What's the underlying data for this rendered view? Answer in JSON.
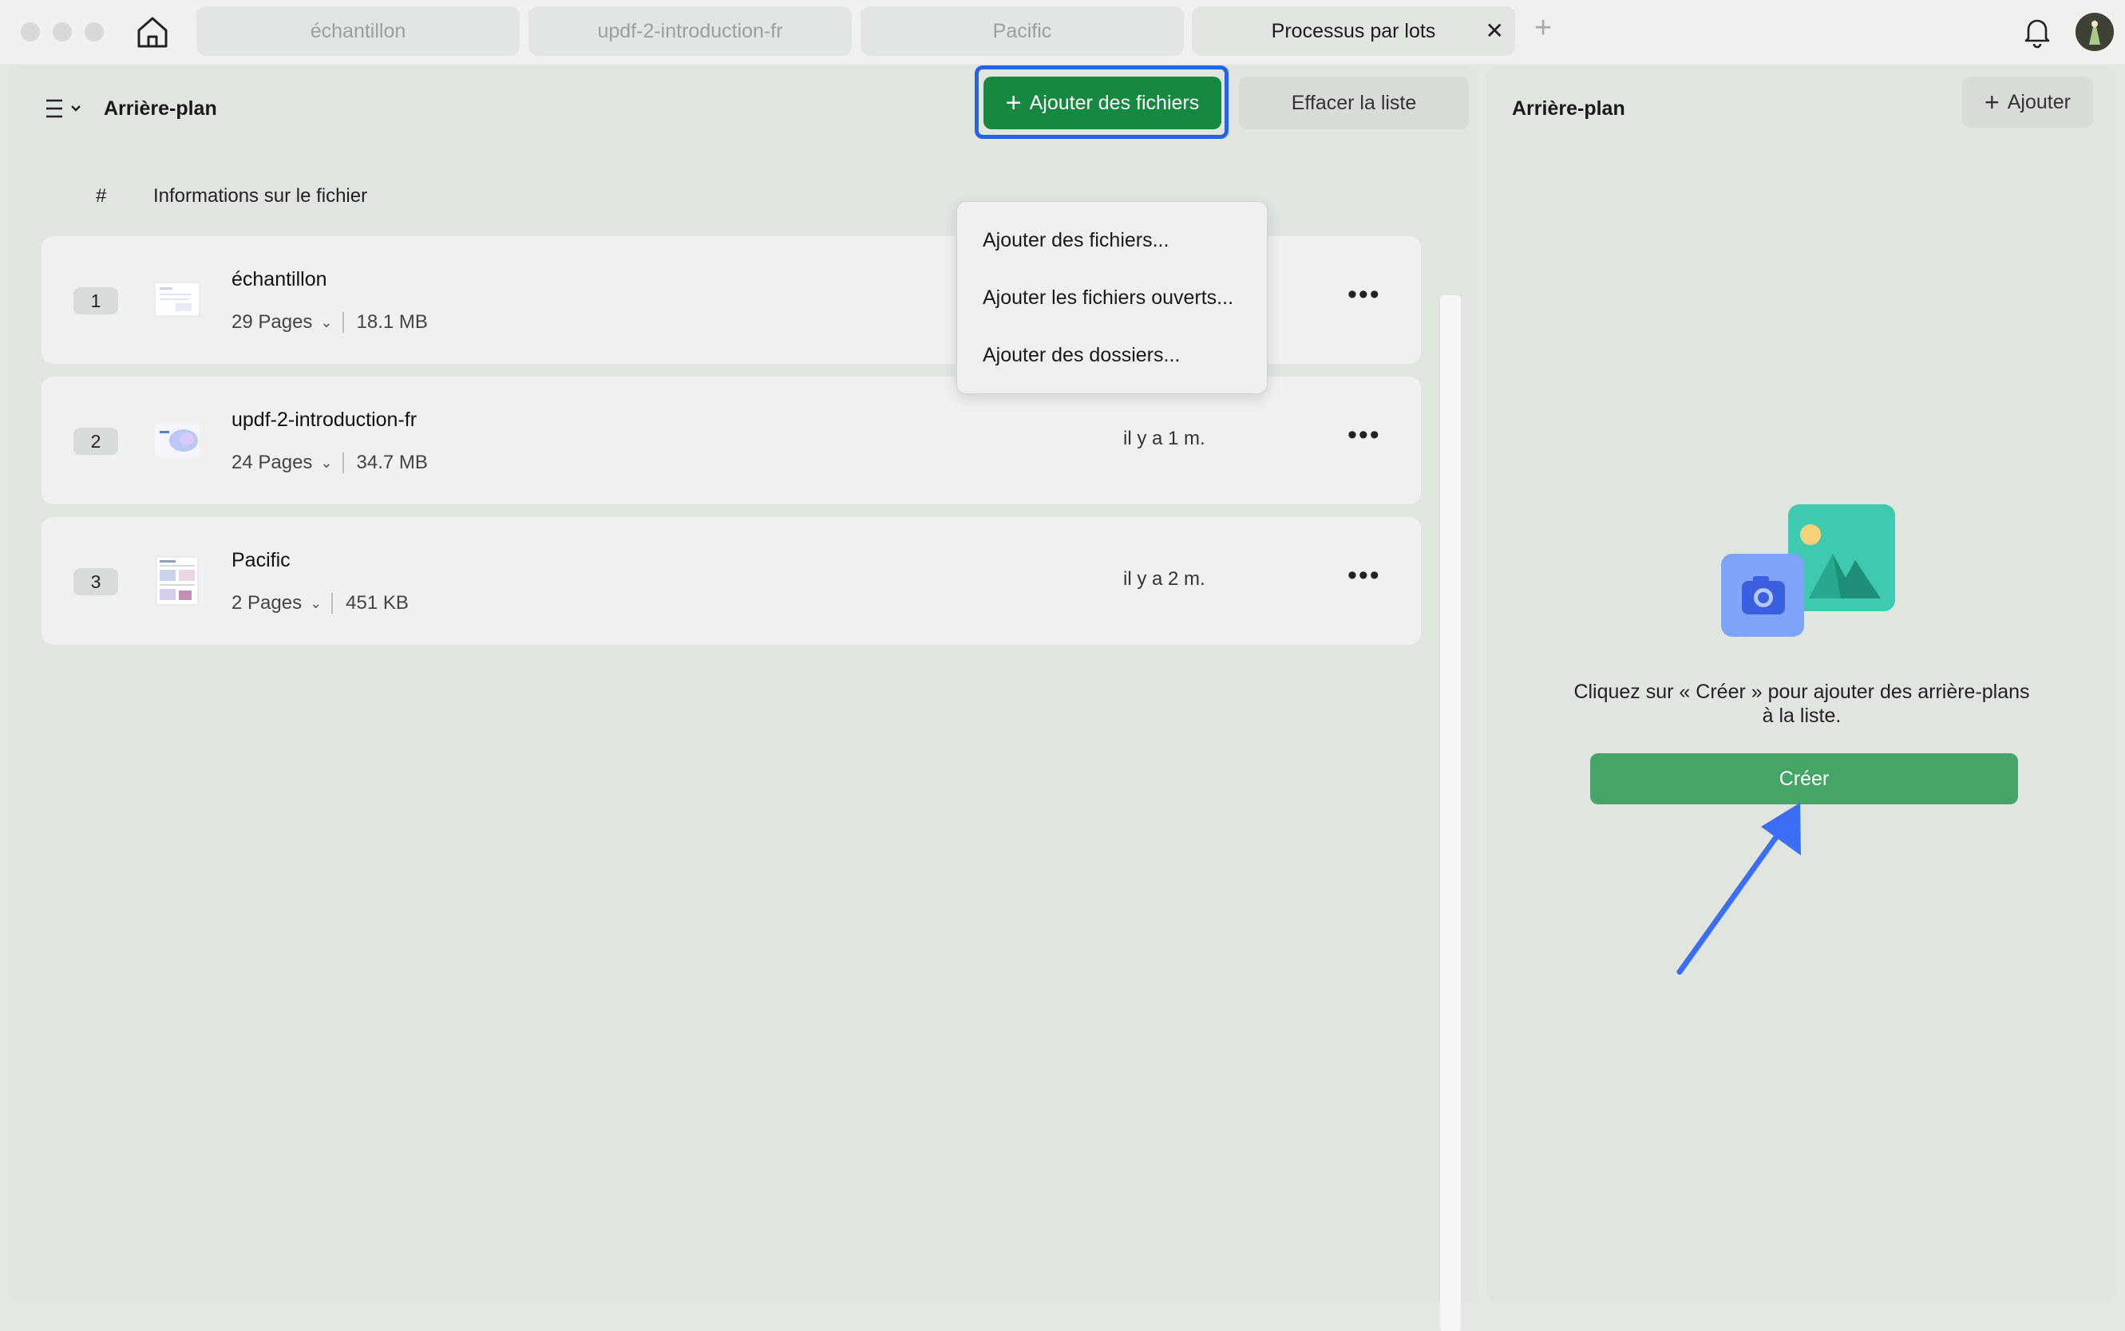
{
  "tabs": [
    {
      "label": "échantillon"
    },
    {
      "label": "updf-2-introduction-fr"
    },
    {
      "label": "Pacific"
    },
    {
      "label": "Processus par lots",
      "active": true
    }
  ],
  "left": {
    "title": "Arrière-plan",
    "add_files_label": "Ajouter des fichiers",
    "clear_label": "Effacer la liste",
    "col_hash": "#",
    "col_info": "Informations sur le fichier",
    "files": [
      {
        "num": "1",
        "name": "échantillon",
        "pages": "29 Pages",
        "size": "18.1 MB",
        "time": ""
      },
      {
        "num": "2",
        "name": "updf-2-introduction-fr",
        "pages": "24 Pages",
        "size": "34.7 MB",
        "time": "il y a 1 m."
      },
      {
        "num": "3",
        "name": "Pacific",
        "pages": "2 Pages",
        "size": "451 KB",
        "time": "il y a 2 m."
      }
    ]
  },
  "dropdown": {
    "items": [
      "Ajouter des fichiers...",
      "Ajouter les fichiers ouverts...",
      "Ajouter des dossiers..."
    ]
  },
  "right": {
    "title": "Arrière-plan",
    "add_label": "Ajouter",
    "message": "Cliquez sur « Créer » pour ajouter des arrière-plans à la liste.",
    "create_label": "Créer"
  },
  "colors": {
    "accent_green": "#16883f",
    "create_green": "#45a567",
    "focus_blue": "#2563eb",
    "annotation_arrow": "#3b6ef5"
  }
}
